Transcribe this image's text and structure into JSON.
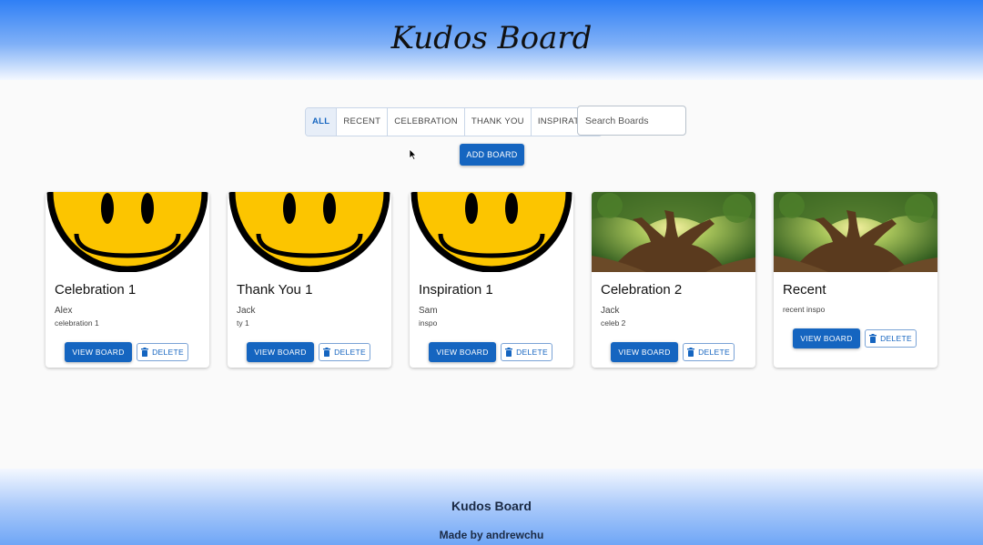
{
  "header": {
    "title": "Kudos Board"
  },
  "filters": {
    "tabs": [
      {
        "label": "ALL",
        "active": true
      },
      {
        "label": "RECENT",
        "active": false
      },
      {
        "label": "CELEBRATION",
        "active": false
      },
      {
        "label": "THANK YOU",
        "active": false
      },
      {
        "label": "INSPIRATION",
        "active": false
      }
    ]
  },
  "search": {
    "placeholder": "Search Boards"
  },
  "add_board_label": "ADD BOARD",
  "cards": [
    {
      "title": "Celebration 1",
      "author": "Alex",
      "description": "celebration 1",
      "image": "smiley-face",
      "view_label": "VIEW BOARD",
      "delete_label": "DELETE"
    },
    {
      "title": "Thank You 1",
      "author": "Jack",
      "description": "ty 1",
      "image": "smiley-face",
      "view_label": "VIEW BOARD",
      "delete_label": "DELETE"
    },
    {
      "title": "Inspiration 1",
      "author": "Sam",
      "description": "inspo",
      "image": "smiley-face",
      "view_label": "VIEW BOARD",
      "delete_label": "DELETE"
    },
    {
      "title": "Celebration 2",
      "author": "Jack",
      "description": "celeb 2",
      "image": "tree-photo",
      "view_label": "VIEW BOARD",
      "delete_label": "DELETE"
    },
    {
      "title": "Recent",
      "author": "",
      "description": "recent inspo",
      "image": "tree-photo",
      "view_label": "VIEW BOARD",
      "delete_label": "DELETE"
    }
  ],
  "footer": {
    "title": "Kudos Board",
    "made_by": "Made by andrewchu"
  },
  "colors": {
    "primary": "#1565c0",
    "header_gradient_top": "#2f7ff5",
    "footer_gradient_bottom": "#6fa6f6",
    "smiley_yellow": "#fcc500"
  }
}
